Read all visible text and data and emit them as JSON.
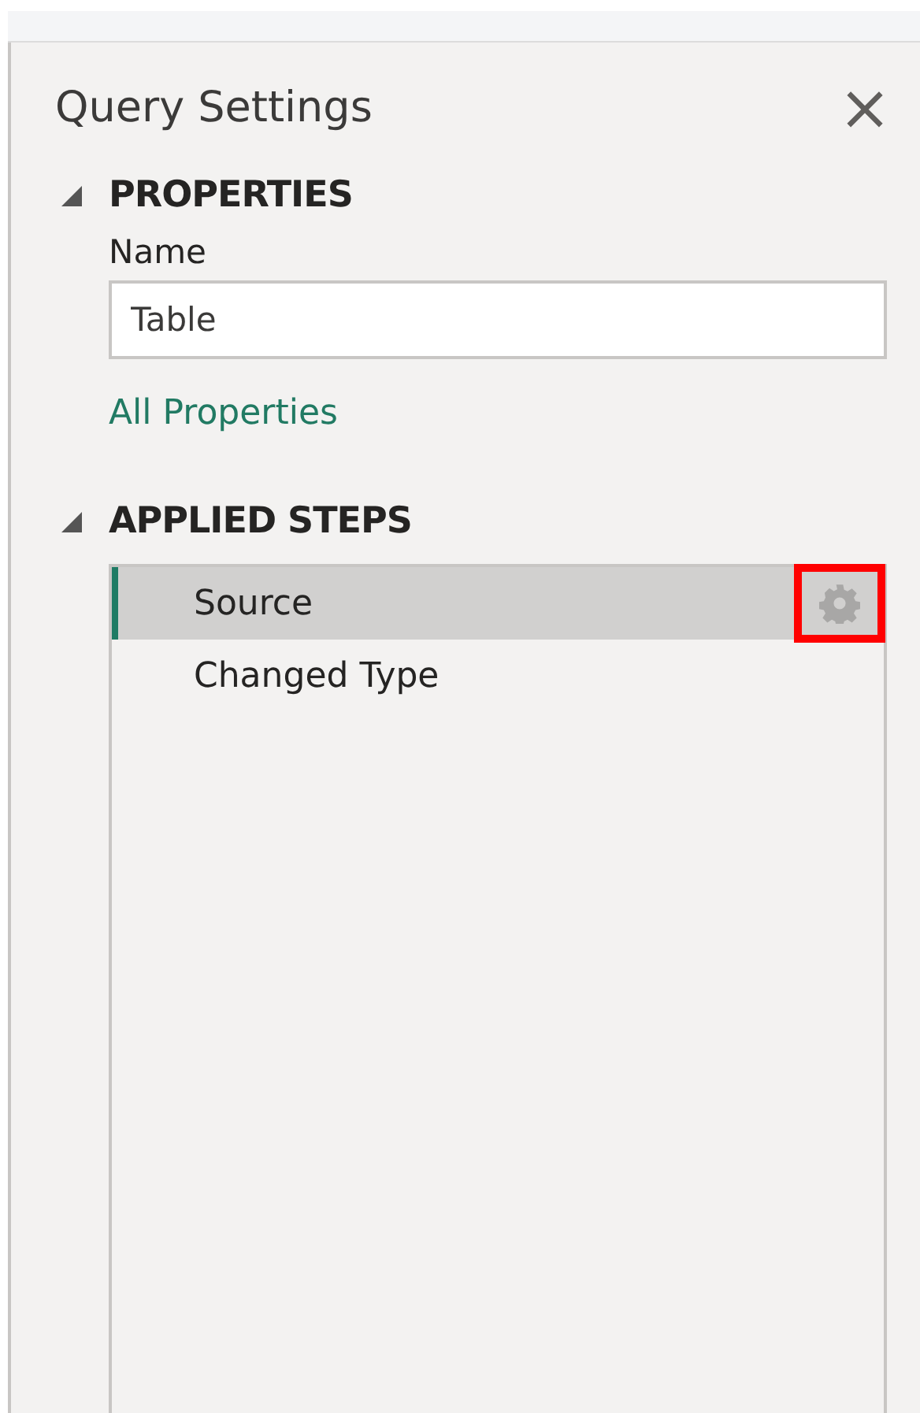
{
  "panel": {
    "title": "Query Settings",
    "close_icon": "×"
  },
  "properties": {
    "heading": "PROPERTIES",
    "expanded": true,
    "name_label": "Name",
    "name_value": "Table",
    "link": "All Properties"
  },
  "applied_steps": {
    "heading": "APPLIED STEPS",
    "expanded": true,
    "steps": [
      {
        "label": "Source",
        "selected": true,
        "settings_highlighted": true
      },
      {
        "label": "Changed Type",
        "selected": false,
        "settings_highlighted": false
      }
    ]
  }
}
